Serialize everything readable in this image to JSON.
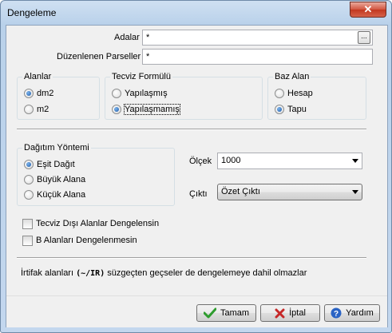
{
  "window": {
    "title": "Dengeleme",
    "close_glyph": "✕"
  },
  "fields": {
    "adalar": {
      "label": "Adalar",
      "value": "*",
      "browse_label": "..."
    },
    "parseller": {
      "label": "Düzenlenen Parseller",
      "value": "*"
    }
  },
  "alanlar": {
    "caption": "Alanlar",
    "options": [
      {
        "label": "dm2",
        "checked": true
      },
      {
        "label": "m2",
        "checked": false
      }
    ]
  },
  "tecviz": {
    "caption": "Tecviz Formülü",
    "options": [
      {
        "label": "Yapılaşmış",
        "checked": false
      },
      {
        "label": "Yapılaşmamış",
        "checked": true
      }
    ]
  },
  "baz": {
    "caption": "Baz Alan",
    "options": [
      {
        "label": "Hesap",
        "checked": false
      },
      {
        "label": "Tapu",
        "checked": true
      }
    ]
  },
  "dagitim": {
    "caption": "Dağıtım Yöntemi",
    "options": [
      {
        "label": "Eşit Dağıt",
        "checked": true
      },
      {
        "label": "Büyük Alana",
        "checked": false
      },
      {
        "label": "Küçük Alana",
        "checked": false
      }
    ]
  },
  "olcek": {
    "label": "Ölçek",
    "value": "1000"
  },
  "cikti": {
    "label": "Çıktı",
    "value": "Özet Çıktı"
  },
  "checks": {
    "tecviz_disi": {
      "label": "Tecviz Dışı Alanlar Dengelensin",
      "checked": false
    },
    "b_alanlari": {
      "label": "B Alanları Dengelenmesin",
      "checked": false
    }
  },
  "info": {
    "prefix": "İrtifak alanları ",
    "code": "(~/IR)",
    "suffix": " süzgeçten geçseler de dengelemeye dahil olmazlar"
  },
  "buttons": {
    "ok": {
      "label": "Tamam",
      "icon": "check-icon",
      "color": "#2e9c2e"
    },
    "cancel": {
      "label": "İptal",
      "icon": "x-icon",
      "color": "#c62828"
    },
    "help": {
      "label": "Yardım",
      "icon": "help-icon",
      "color": "#2a63c4"
    }
  }
}
